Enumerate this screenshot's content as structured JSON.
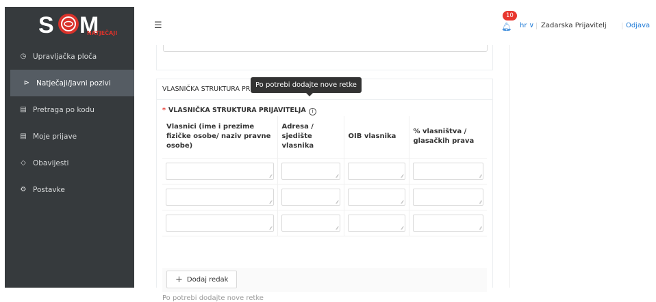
{
  "logo": {
    "text": "NATJEČAJI"
  },
  "sidebar": {
    "items": [
      {
        "label": "Upravljačka ploča",
        "icon": "dashboard-icon",
        "glyph": "◷"
      },
      {
        "label": "Natječaji/Javni pozivi",
        "icon": "folder-open-icon",
        "glyph": "⊳"
      },
      {
        "label": "Pretraga po kodu",
        "icon": "file-search-icon",
        "glyph": "▤"
      },
      {
        "label": "Moje prijave",
        "icon": "file-icon",
        "glyph": "▤"
      },
      {
        "label": "Obavijesti",
        "icon": "bell-icon",
        "glyph": "◇"
      },
      {
        "label": "Postavke",
        "icon": "settings-icon",
        "glyph": "⚙"
      }
    ]
  },
  "header": {
    "notification_count": "10",
    "language": "hr ∨",
    "user": "Zadarska Prijavitelj",
    "logout": "Odjava"
  },
  "section": {
    "title": "VLASNIČKA STRUKTURA PRIJAVITELJA",
    "tooltip": "Po potrebi dodajte nove retke",
    "field_label": "VLASNIČKA STRUKTURA PRIJAVITELJA",
    "info_icon": "i",
    "columns": [
      "Vlasnici (ime i prezime fizičke osobe/ naziv pravne osobe)",
      "Adresa / sjedište vlasnika",
      "OIB vlasnika",
      "% vlasništva / glasačkih prava"
    ],
    "add_row_label": "Dodaj redak",
    "help_text": "Po potrebi dodajte nove retke"
  },
  "colors": {
    "sidebar": "#363a3d",
    "active": "#555c63",
    "accent": "#1e7ad6",
    "badge": "#e8372f",
    "logo_red": "#d9322b"
  }
}
